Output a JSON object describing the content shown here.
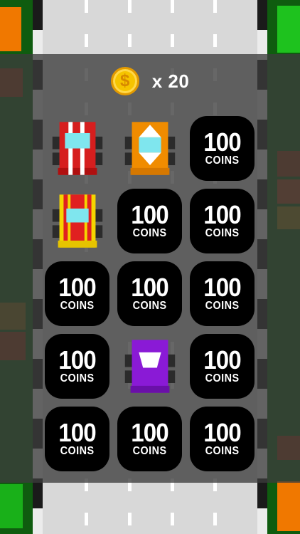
{
  "currency": {
    "icon": "dollar-coin-icon",
    "symbol": "$",
    "count_label": "x 20"
  },
  "garage": {
    "tiles": [
      {
        "type": "car",
        "car": "red-striped-car",
        "color": "#d61e1e"
      },
      {
        "type": "car",
        "car": "orange-arrow-car",
        "color": "#f08c00"
      },
      {
        "type": "locked",
        "amount": "100",
        "unit": "COINS"
      },
      {
        "type": "car",
        "car": "yellow-red-car",
        "color": "#f5d500"
      },
      {
        "type": "locked",
        "amount": "100",
        "unit": "COINS"
      },
      {
        "type": "locked",
        "amount": "100",
        "unit": "COINS"
      },
      {
        "type": "locked",
        "amount": "100",
        "unit": "COINS"
      },
      {
        "type": "locked",
        "amount": "100",
        "unit": "COINS"
      },
      {
        "type": "locked",
        "amount": "100",
        "unit": "COINS"
      },
      {
        "type": "locked",
        "amount": "100",
        "unit": "COINS"
      },
      {
        "type": "car",
        "car": "purple-car",
        "color": "#8a1ad6"
      },
      {
        "type": "locked",
        "amount": "100",
        "unit": "COINS"
      },
      {
        "type": "locked",
        "amount": "100",
        "unit": "COINS"
      },
      {
        "type": "locked",
        "amount": "100",
        "unit": "COINS"
      },
      {
        "type": "locked",
        "amount": "100",
        "unit": "COINS"
      }
    ]
  },
  "colors": {
    "overlay": "#3c3c3c",
    "tile_locked": "#000000",
    "coin": "#f6c400",
    "grass": "#0f5c0f"
  }
}
